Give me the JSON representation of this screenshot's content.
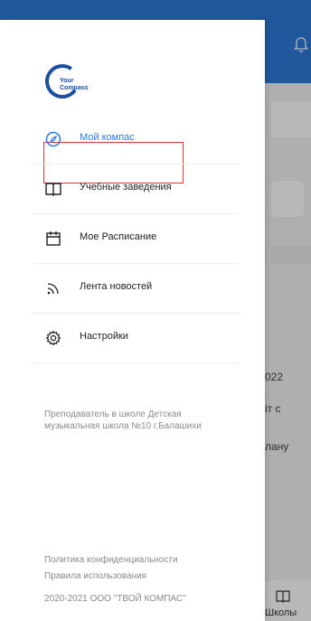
{
  "drawer": {
    "logo": {
      "line1": "Your",
      "line2": "Compass"
    },
    "menu": [
      {
        "label": "Мой компас",
        "icon": "compass-icon",
        "active": true
      },
      {
        "label": "Учебные заведения",
        "icon": "book-icon",
        "active": false
      },
      {
        "label": "Мое Расписание",
        "icon": "calendar-icon",
        "active": false
      },
      {
        "label": "Лента новостей",
        "icon": "rss-icon",
        "active": false
      },
      {
        "label": "Настройки",
        "icon": "gear-icon",
        "active": false
      }
    ],
    "teacher_info": "Преподаватель в школе Детская музыкальная школа №10 г.Балашихи",
    "footer": {
      "privacy": "Политика конфиденциальности",
      "terms": "Правила использования",
      "copyright": "2020-2021 ООО \"ТВОЙ КОМПАС\""
    }
  },
  "background": {
    "fragments": [
      "022",
      "іт с",
      "лану"
    ],
    "bottom_tab_label": "Школы"
  },
  "colors": {
    "accent": "#2e7bd9",
    "highlight_border": "#e0303a"
  }
}
